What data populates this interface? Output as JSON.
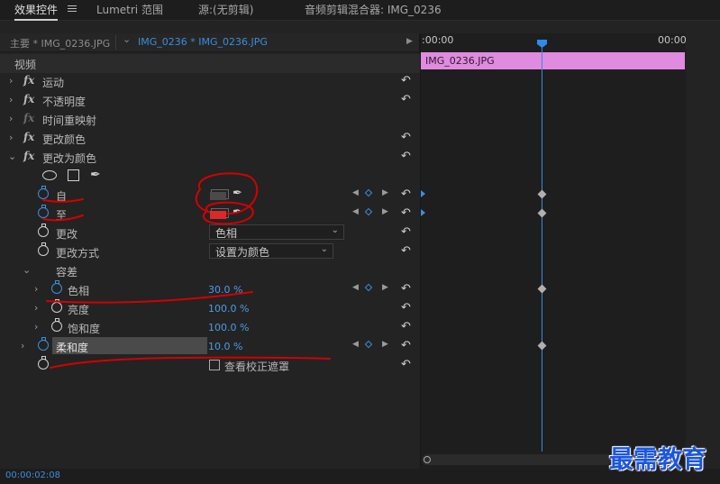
{
  "panel_tabs": [
    "效果控件",
    "Lumetri 范围",
    "源:(无剪辑)",
    "音频剪辑混合器: IMG_0236"
  ],
  "sub_tabs": {
    "master": "主要 * IMG_0236.JPG",
    "active": "IMG_0236 * IMG_0236.JPG",
    "chevron": "⌄",
    "play": "▶"
  },
  "section": "视频",
  "effects": [
    "运动",
    "不透明度",
    "时间重映射",
    "更改颜色",
    "更改为颜色"
  ],
  "params": {
    "from": {
      "label": "自",
      "color": "#4a4a4a"
    },
    "to": {
      "label": "至",
      "color": "#d82a2a"
    },
    "change": {
      "label": "更改",
      "value": "色相"
    },
    "change_by": {
      "label": "更改方式",
      "value": "设置为颜色"
    },
    "tolerance": {
      "label": "容差"
    },
    "hue": {
      "label": "色相",
      "value": "30.0 %"
    },
    "lightness": {
      "label": "亮度",
      "value": "100.0 %"
    },
    "saturation": {
      "label": "饱和度",
      "value": "100.0 %"
    },
    "softness": {
      "label": "柔和度",
      "value": "10.0 %"
    },
    "view_mask": {
      "label": "查看校正遮罩"
    }
  },
  "timeline": {
    "start_time": ":00:00",
    "end_time": "00:00",
    "clip_name": "IMG_0236.JPG"
  },
  "timecode": "00:00:02:08",
  "watermark": "最需教育",
  "glyphs": {
    "reset": "↶",
    "expand": "›",
    "collapse": "⌄",
    "prev_kf": "◀",
    "next_kf": "▶",
    "eyedropper": "✒",
    "pen": "✒"
  },
  "colors": {
    "accent": "#2d8ceb",
    "clip": "#e08ae0",
    "annotation": "#d40000",
    "watermark": "#1b56e0"
  }
}
